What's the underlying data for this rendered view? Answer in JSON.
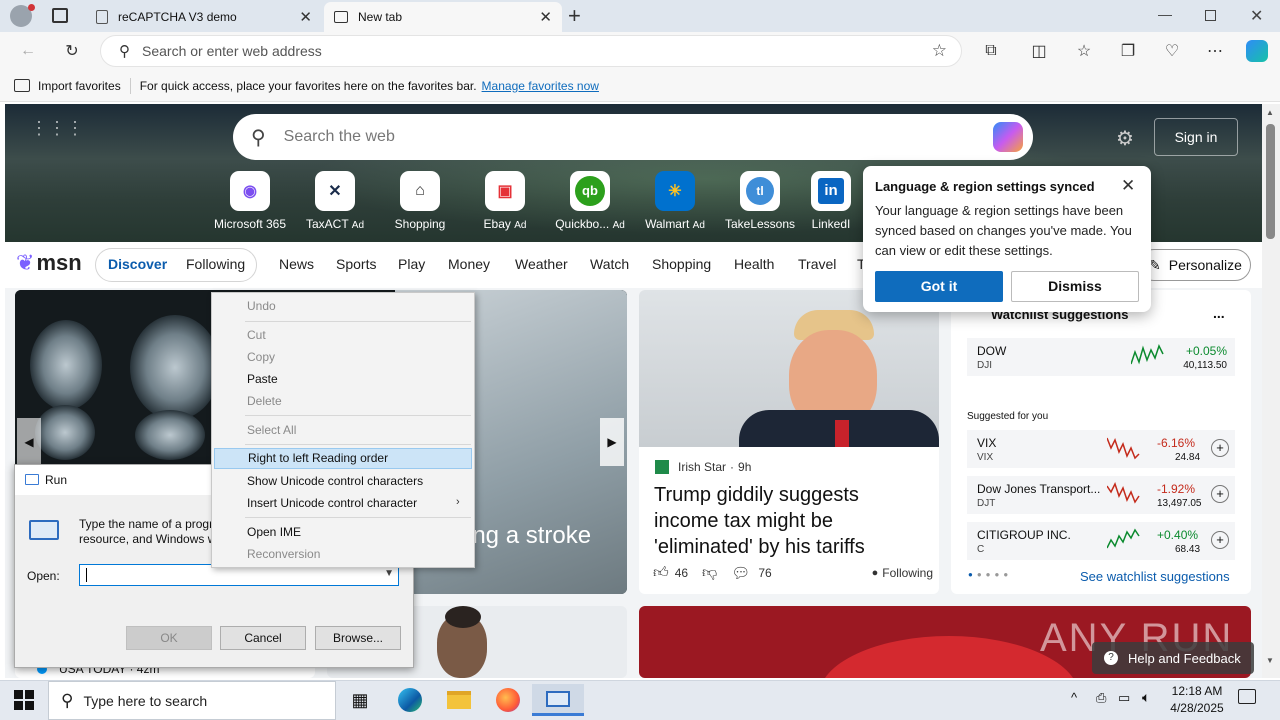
{
  "browser": {
    "tabs": [
      {
        "title": "reCAPTCHA V3 demo"
      },
      {
        "title": "New tab"
      }
    ],
    "address_placeholder": "Search or enter web address",
    "favorites_bar": {
      "import_label": "Import favorites",
      "message": "For quick access, place your favorites here on the favorites bar.",
      "manage_link": "Manage favorites now"
    }
  },
  "newtab": {
    "search_placeholder": "Search the web",
    "sign_in": "Sign in",
    "quick_links": [
      {
        "label": "Microsoft 365",
        "ad": ""
      },
      {
        "label": "TaxACT",
        "ad": "Ad"
      },
      {
        "label": "Shopping",
        "ad": ""
      },
      {
        "label": "Ebay",
        "ad": "Ad"
      },
      {
        "label": "Quickbo...",
        "ad": "Ad"
      },
      {
        "label": "Walmart",
        "ad": "Ad"
      },
      {
        "label": "TakeLessons",
        "ad": ""
      },
      {
        "label": "LinkedI",
        "ad": ""
      }
    ],
    "msn_logo": "msn",
    "nav": {
      "discover": "Discover",
      "following": "Following",
      "items": [
        "News",
        "Sports",
        "Play",
        "Money",
        "Weather",
        "Watch",
        "Shopping",
        "Health",
        "Travel",
        "T"
      ],
      "personalize": "Personalize"
    }
  },
  "feed": {
    "headline_fragment": "ying a stroke",
    "bottom_source": "USA TODAY · 4zm",
    "trump_card": {
      "source": "Irish Star",
      "age": "9h",
      "headline": "Trump giddily suggests income tax might be 'eliminated' by his tariffs",
      "likes": "46",
      "comments": "76",
      "following": "Following"
    },
    "watchlist": {
      "title": "Watchlist suggestions",
      "more": "...",
      "suggested_label": "Suggested for you",
      "see_more": "See watchlist suggestions",
      "items": [
        {
          "name": "DOW",
          "ticker": "DJI",
          "change": "+0.05%",
          "price": "40,113.50",
          "trend": "up"
        },
        {
          "name": "VIX",
          "ticker": "VIX",
          "change": "-6.16%",
          "price": "24.84",
          "trend": "down"
        },
        {
          "name": "Dow Jones Transport...",
          "ticker": "DJT",
          "change": "-1.92%",
          "price": "13,497.05",
          "trend": "down"
        },
        {
          "name": "CITIGROUP INC.",
          "ticker": "C",
          "change": "+0.40%",
          "price": "68.43",
          "trend": "up"
        }
      ]
    },
    "help_feedback": "Help and Feedback",
    "watermark": "ANY RUN"
  },
  "toast": {
    "title": "Language & region settings synced",
    "body": "Your language & region settings have been synced based on changes you've made. You can view or edit these settings.",
    "primary": "Got it",
    "secondary": "Dismiss"
  },
  "context_menu": {
    "items": [
      {
        "label": "Undo",
        "state": "disabled"
      },
      {
        "label": "Cut",
        "state": "disabled"
      },
      {
        "label": "Copy",
        "state": "disabled"
      },
      {
        "label": "Paste",
        "state": "enabled"
      },
      {
        "label": "Delete",
        "state": "disabled"
      },
      {
        "label": "Select All",
        "state": "disabled"
      },
      {
        "label": "Right to left Reading order",
        "state": "selected"
      },
      {
        "label": "Show Unicode control characters",
        "state": "enabled"
      },
      {
        "label": "Insert Unicode control character",
        "state": "submenu"
      },
      {
        "label": "Open IME",
        "state": "enabled"
      },
      {
        "label": "Reconversion",
        "state": "disabled"
      }
    ]
  },
  "run_dialog": {
    "title": "Run",
    "description": "Type the name of a program, folder, document, or Internet resource, and Windows will open it for you.",
    "open_label": "Open:",
    "open_value": "",
    "ok": "OK",
    "cancel": "Cancel",
    "browse": "Browse..."
  },
  "taskbar": {
    "search_placeholder": "Type here to search",
    "time": "12:18 AM",
    "date": "4/28/2025"
  },
  "colors": {
    "accent": "#0f6cbd",
    "msn_blue": "#0b5cad",
    "positive": "#0b8a2e",
    "negative": "#c42b1c"
  }
}
